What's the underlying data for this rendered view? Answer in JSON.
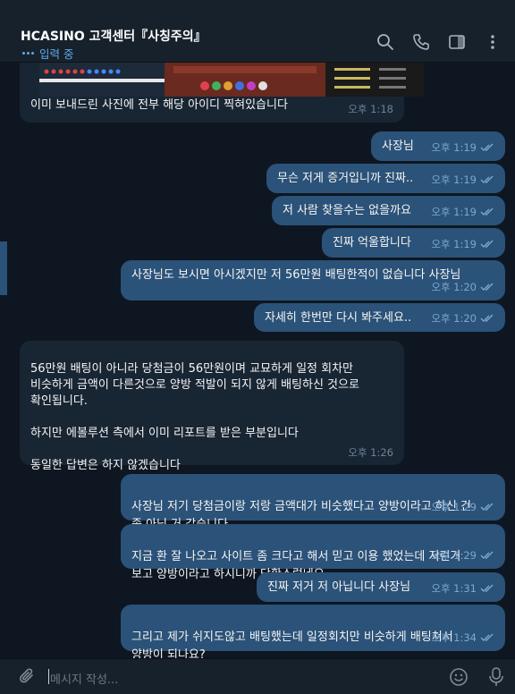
{
  "header": {
    "title": "HCASINO 고객센터『사칭주의』",
    "status": "입력 중"
  },
  "messages": [
    {
      "text": "이미 보내드린 사진에 전부 해당 아이디 찍혀있습니다",
      "time": "오후 1:18",
      "dir": "in"
    },
    {
      "text": "사장님",
      "time": "오후 1:19",
      "dir": "out"
    },
    {
      "text": "무슨 저게 증거입니까 진짜..",
      "time": "오후 1:19",
      "dir": "out"
    },
    {
      "text": "저 사람 찾을수는 없을까요",
      "time": "오후 1:19",
      "dir": "out"
    },
    {
      "text": "진짜 억울합니다",
      "time": "오후 1:19",
      "dir": "out"
    },
    {
      "text": "사장님도 보시면 아시겠지만 저 56만원 배팅한적이 없습니다 사장님",
      "time": "오후 1:20",
      "dir": "out"
    },
    {
      "text": "자세히 한번만 다시 봐주세요..",
      "time": "오후 1:20",
      "dir": "out"
    },
    {
      "text": "56만원 배팅이 아니라 당첨금이 56만원이며 교묘하게 일정 회차만\n비슷하게 금액이 다른것으로 양방 적발이 되지 않게 배팅하신 것으로\n확인됩니다.\n\n하지만 에볼루션 측에서 이미 리포트를 받은 부분입니다\n\n동일한 답변은 하지 않겠습니다",
      "time": "오후 1:26",
      "dir": "in"
    },
    {
      "text": "사장님 저기 당첨금이랑 저랑 금액대가 비슷했다고 양방이라고 하신 건\n좀 아닌 거 같습니다.",
      "time": "오후 1:29",
      "dir": "out"
    },
    {
      "text": "지금 환 잘 나오고 사이트 좀 크다고 해서 믿고 이용 했었는데 저런거\n보고 양방이라고 하시니까 당황스럽네요",
      "time": "오후 1:29",
      "dir": "out"
    },
    {
      "text": "진짜 저거 저 아닙니다 사장님",
      "time": "오후 1:31",
      "dir": "out"
    },
    {
      "text": "그리고 제가 쉬지도않고 배팅했는데 일정회치만 비슷하게 배팅쳐서\n양방이 되나요?",
      "time": "오후 1:34",
      "dir": "out"
    }
  ],
  "footer": {
    "placeholder": "메시지 작성..."
  },
  "colors": {
    "incoming": "#182533",
    "outgoing": "#2b5278",
    "accent": "#5fa8e8"
  },
  "icons": [
    "search-icon",
    "phone-icon",
    "sidebar-icon",
    "more-icon",
    "attach-icon",
    "emoji-icon",
    "mic-icon"
  ]
}
